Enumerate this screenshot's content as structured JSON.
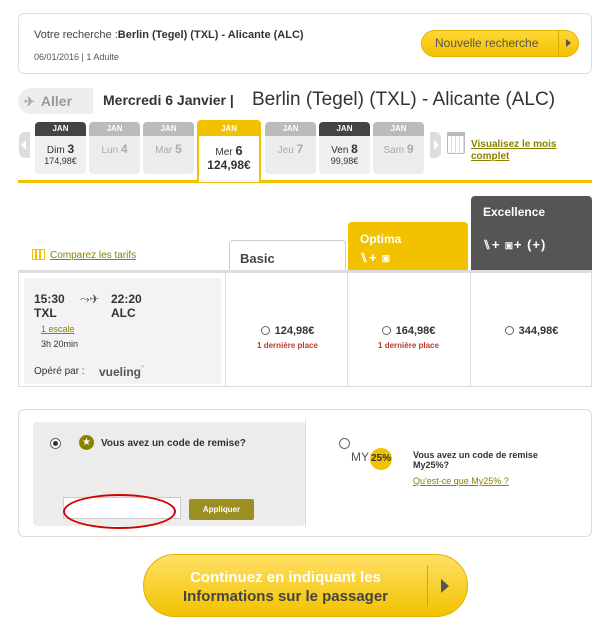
{
  "summary": {
    "label": "Votre recherche :",
    "route": "Berlin (Tegel) (TXL) - Alicante (ALC)",
    "details": "06/01/2016 | 1 Adulte",
    "new_search": "Nouvelle recherche"
  },
  "direction": {
    "label": "Aller",
    "date": "Mercredi 6 Janvier",
    "separator": "|",
    "route": "Berlin (Tegel) (TXL) - Alicante (ALC)"
  },
  "calendar": {
    "month_link": "Visualisez le mois complet",
    "days": [
      {
        "month": "JAN",
        "day": "Dim",
        "num": "3",
        "price": "174,98€",
        "available": true
      },
      {
        "month": "JAN",
        "day": "Lun",
        "num": "4",
        "price": "",
        "available": false
      },
      {
        "month": "JAN",
        "day": "Mar",
        "num": "5",
        "price": "",
        "available": false
      },
      {
        "month": "JAN",
        "day": "Mer",
        "num": "6",
        "price": "124,98€",
        "available": true,
        "selected": true
      },
      {
        "month": "JAN",
        "day": "Jeu",
        "num": "7",
        "price": "",
        "available": false
      },
      {
        "month": "JAN",
        "day": "Ven",
        "num": "8",
        "price": "99,98€",
        "available": true
      },
      {
        "month": "JAN",
        "day": "Sam",
        "num": "9",
        "price": "",
        "available": false
      }
    ]
  },
  "fares": {
    "compare_link": "Comparez les tarifs",
    "columns": {
      "basic": "Basic",
      "optima": "Optima",
      "excellence": "Excellence"
    },
    "flight": {
      "dep_time": "15:30",
      "arr_time": "22:20",
      "dep_code": "TXL",
      "arr_code": "ALC",
      "stops": "1 escale",
      "duration": "3h 20min",
      "operated_by": "Opéré par :",
      "carrier": "vueling"
    },
    "prices": [
      {
        "price": "124,98€",
        "note": "1 dernière place"
      },
      {
        "price": "164,98€",
        "note": "1 dernière place"
      },
      {
        "price": "344,98€",
        "note": ""
      }
    ]
  },
  "discount": {
    "question": "Vous avez un code de remise?",
    "input_value": "",
    "apply": "Appliquer",
    "my25_prefix": "MY",
    "my25_badge": "25%",
    "my25_question": "Vous avez un code de remise My25%?",
    "my25_link": "Qu'est-ce que My25% ?"
  },
  "continue_button": {
    "line1": "Continuez en indiquant les",
    "line2": "Informations sur le passager"
  },
  "colors": {
    "accent": "#f2c200",
    "dark": "#555555",
    "link": "#8a8200",
    "warning": "#c0392b"
  }
}
